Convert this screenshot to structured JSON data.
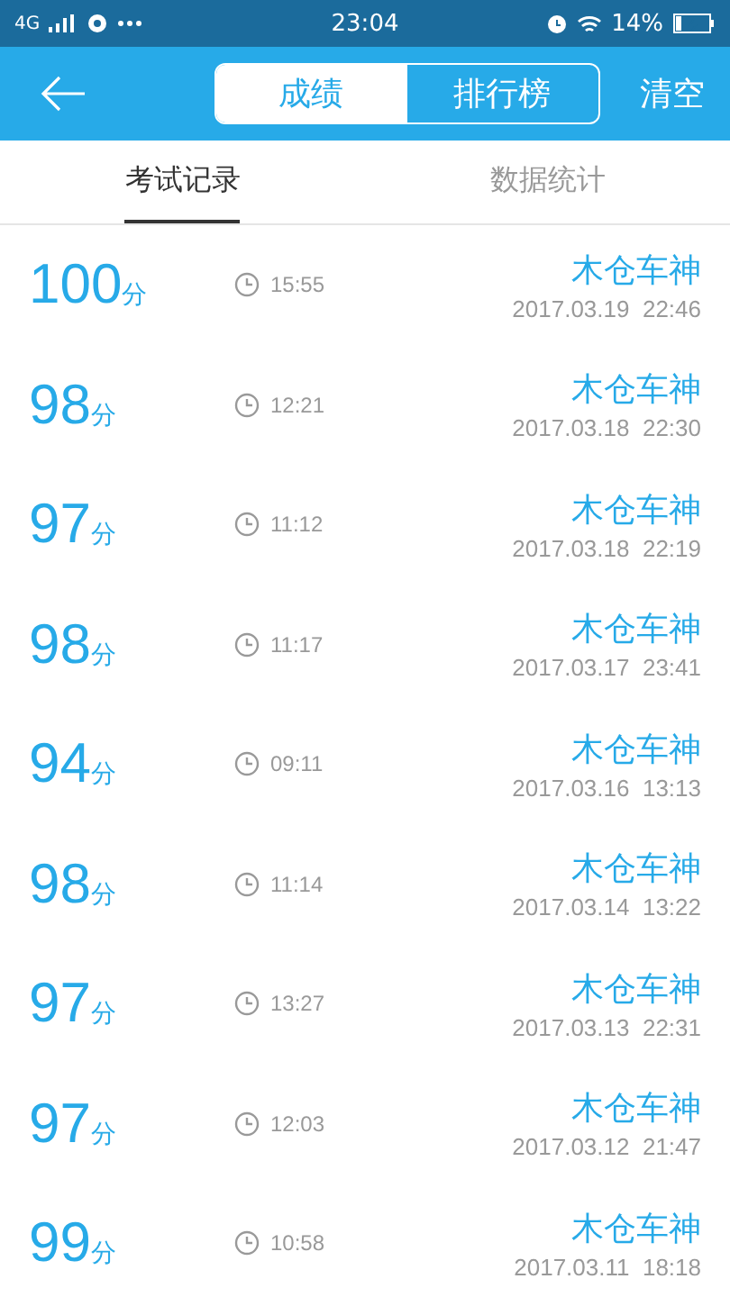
{
  "status_bar": {
    "network": "4G",
    "time": "23:04",
    "battery": "14%"
  },
  "header": {
    "segments": [
      {
        "label": "成绩",
        "selected": true
      },
      {
        "label": "排行榜",
        "selected": false
      }
    ],
    "action": "清空"
  },
  "tabs": [
    {
      "label": "考试记录",
      "selected": true
    },
    {
      "label": "数据统计",
      "selected": false
    }
  ],
  "records": [
    {
      "score": "100",
      "unit": "分",
      "duration": "15:55",
      "name": "木仓车神",
      "date": "2017.03.19  22:46"
    },
    {
      "score": "98",
      "unit": "分",
      "duration": "12:21",
      "name": "木仓车神",
      "date": "2017.03.18  22:30"
    },
    {
      "score": "97",
      "unit": "分",
      "duration": "11:12",
      "name": "木仓车神",
      "date": "2017.03.18  22:19"
    },
    {
      "score": "98",
      "unit": "分",
      "duration": "11:17",
      "name": "木仓车神",
      "date": "2017.03.17  23:41"
    },
    {
      "score": "94",
      "unit": "分",
      "duration": "09:11",
      "name": "木仓车神",
      "date": "2017.03.16  13:13"
    },
    {
      "score": "98",
      "unit": "分",
      "duration": "11:14",
      "name": "木仓车神",
      "date": "2017.03.14  13:22"
    },
    {
      "score": "97",
      "unit": "分",
      "duration": "13:27",
      "name": "木仓车神",
      "date": "2017.03.13  22:31"
    },
    {
      "score": "97",
      "unit": "分",
      "duration": "12:03",
      "name": "木仓车神",
      "date": "2017.03.12  21:47"
    },
    {
      "score": "99",
      "unit": "分",
      "duration": "10:58",
      "name": "木仓车神",
      "date": "2017.03.11  18:18"
    }
  ]
}
